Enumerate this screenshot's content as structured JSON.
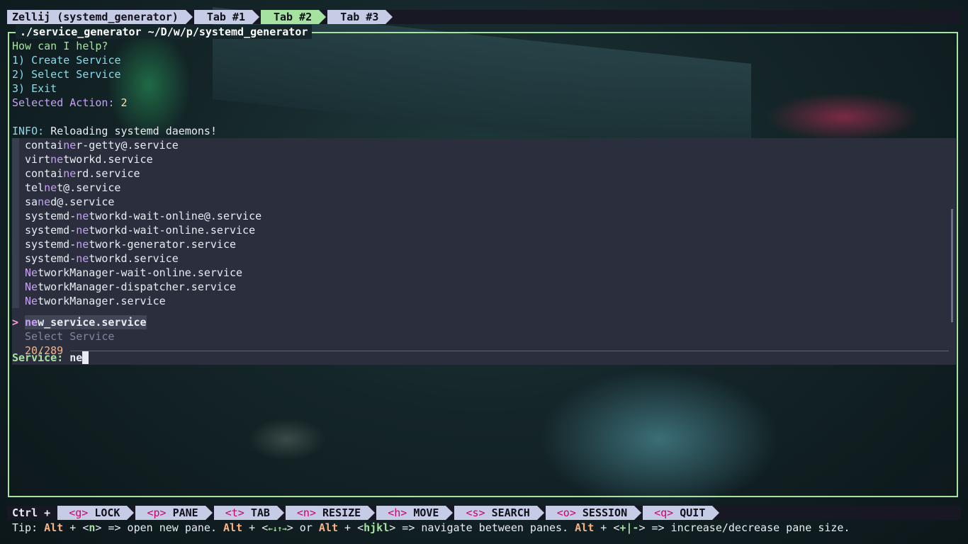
{
  "tabbar": {
    "session": "Zellij (systemd_generator)",
    "tabs": [
      "Tab #1",
      "Tab #2",
      "Tab #3"
    ],
    "active_tab": 1
  },
  "pane": {
    "title": "./service_generator ~/D/w/p/systemd_generator"
  },
  "menu": {
    "prompt": "How can I help?",
    "options": [
      "1) Create Service",
      "2) Select Service",
      "3) Exit"
    ],
    "selected_label": "Selected Action:",
    "selected_value": "2"
  },
  "info": {
    "label": "INFO:",
    "message": "Reloading systemd daemons!"
  },
  "fzf": {
    "items": [
      {
        "pre": "contai",
        "match": "ne",
        "post": "r-getty@.service"
      },
      {
        "pre": "virt",
        "match": "ne",
        "post": "tworkd.service"
      },
      {
        "pre": "contai",
        "match": "ne",
        "post": "rd.service"
      },
      {
        "pre": "tel",
        "match": "ne",
        "post": "t@.service"
      },
      {
        "pre": "sa",
        "match": "ne",
        "post": "d@.service"
      },
      {
        "pre": "systemd-",
        "match": "ne",
        "post": "tworkd-wait-online@.service"
      },
      {
        "pre": "systemd-",
        "match": "ne",
        "post": "tworkd-wait-online.service"
      },
      {
        "pre": "systemd-",
        "match": "ne",
        "post": "twork-generator.service"
      },
      {
        "pre": "systemd-",
        "match": "ne",
        "post": "tworkd.service"
      },
      {
        "pre": "",
        "match": "Ne",
        "post": "tworkManager-wait-online.service"
      },
      {
        "pre": "",
        "match": "Ne",
        "post": "tworkManager-dispatcher.service"
      },
      {
        "pre": "",
        "match": "Ne",
        "post": "tworkManager.service"
      }
    ],
    "selected": {
      "pointer": ">",
      "match": "ne",
      "post": "w_service.service"
    },
    "header": "Select Service",
    "count": "20/289",
    "query_label": "Service:",
    "query": "ne"
  },
  "statusbar": {
    "ctrl": "Ctrl +",
    "keys": [
      {
        "key": "<g>",
        "label": "LOCK"
      },
      {
        "key": "<p>",
        "label": "PANE"
      },
      {
        "key": "<t>",
        "label": "TAB"
      },
      {
        "key": "<n>",
        "label": "RESIZE"
      },
      {
        "key": "<h>",
        "label": "MOVE"
      },
      {
        "key": "<s>",
        "label": "SEARCH"
      },
      {
        "key": "<o>",
        "label": "SESSION"
      },
      {
        "key": "<q>",
        "label": "QUIT"
      }
    ]
  },
  "tip": {
    "prefix": "Tip: ",
    "alt1": "Alt",
    "t1": " + <",
    "k1": "n",
    "t2": "> => open new pane. ",
    "alt2": "Alt",
    "t3": " + <",
    "k2": "←↓↑→",
    "t4": "> or ",
    "alt3": "Alt",
    "t5": " + <",
    "k3": "hjkl",
    "t6": "> => navigate between panes. ",
    "alt4": "Alt",
    "t7": " + <",
    "k4": "+|-",
    "t8": "> => increase/decrease pane size."
  }
}
